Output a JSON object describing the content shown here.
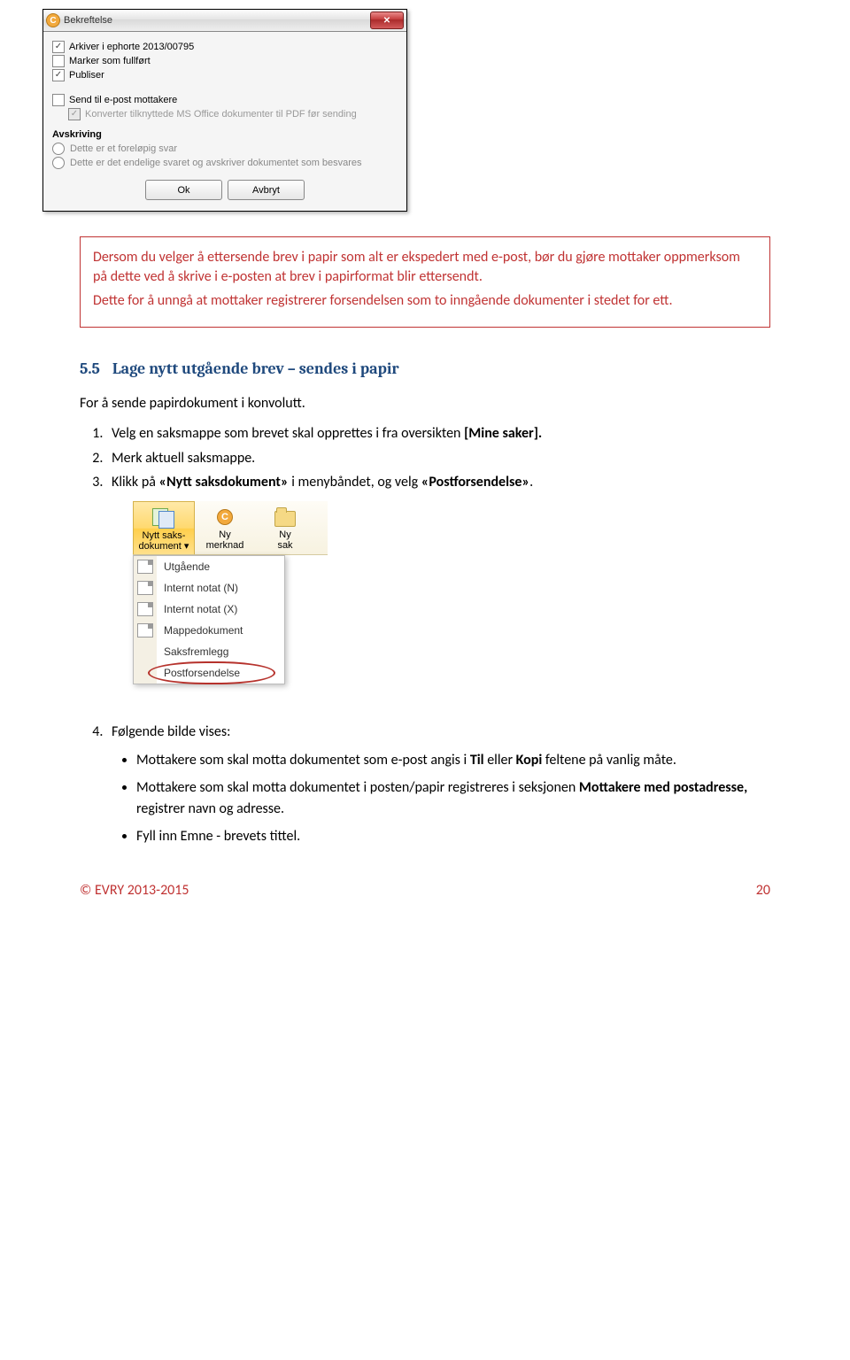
{
  "dialog": {
    "title": "Bekreftelse",
    "cb_archive": "Arkiver i ephorte 2013/00795",
    "cb_fullfort": "Marker som fullført",
    "cb_publiser": "Publiser",
    "cb_sendepost": "Send til e-post mottakere",
    "cb_konverter": "Konverter tilknyttede MS Office dokumenter til PDF før sending",
    "section_avskriving": "Avskriving",
    "radio_forelopig": "Dette er et foreløpig svar",
    "radio_endelig": "Dette er det endelige svaret og avskriver dokumentet som besvares",
    "btn_ok": "Ok",
    "btn_avbryt": "Avbryt"
  },
  "redbox": {
    "p1": "Dersom du velger å ettersende brev i papir som alt er ekspedert med e-post, bør du gjøre mottaker oppmerksom på dette ved å skrive i e-posten at brev i papirformat blir ettersendt.",
    "p2": "Dette for å unngå at mottaker registrerer forsendelsen som to inngående dokumenter i stedet for ett."
  },
  "heading55": {
    "num": "5.5",
    "title": "Lage nytt utgående brev – sendes i papir"
  },
  "intro": "For å sende papirdokument i konvolutt.",
  "steps": {
    "s1_a": "Velg en saksmappe som brevet skal opprettes i fra oversikten ",
    "s1_b": "[Mine saker].",
    "s2": "Merk aktuell saksmappe.",
    "s3_a": "Klikk på ",
    "s3_b": "«Nytt saksdokument»",
    "s3_c": " i menybåndet, og velg ",
    "s3_d": "«Postforsendelse»",
    "s3_e": "."
  },
  "ribbon": {
    "r1a": "Nytt saks-",
    "r1b": "dokument",
    "r2a": "Ny",
    "r2b": "merknad",
    "r3a": "Ny",
    "r3b": "sak"
  },
  "dropdown": {
    "i1": "Utgående",
    "i2": "Internt notat (N)",
    "i3": "Internt notat (X)",
    "i4": "Mappedokument",
    "i5": "Saksfremlegg",
    "i6": "Postforsendelse"
  },
  "step4": {
    "lead": "Følgende bilde vises:",
    "b1_a": "Mottakere som skal motta dokumentet som e-post angis i ",
    "b1_b": "Til",
    "b1_c": " eller ",
    "b1_d": "Kopi",
    "b1_e": " feltene på vanlig måte.",
    "b2_a": "Mottakere som skal motta dokumentet i posten/papir registreres i seksjonen ",
    "b2_b": "Mottakere med postadresse,",
    "b2_c": " registrer navn og adresse.",
    "b3": "Fyll inn Emne - brevets tittel."
  },
  "footer": {
    "copy": "© EVRY 2013-2015",
    "page": "20"
  }
}
